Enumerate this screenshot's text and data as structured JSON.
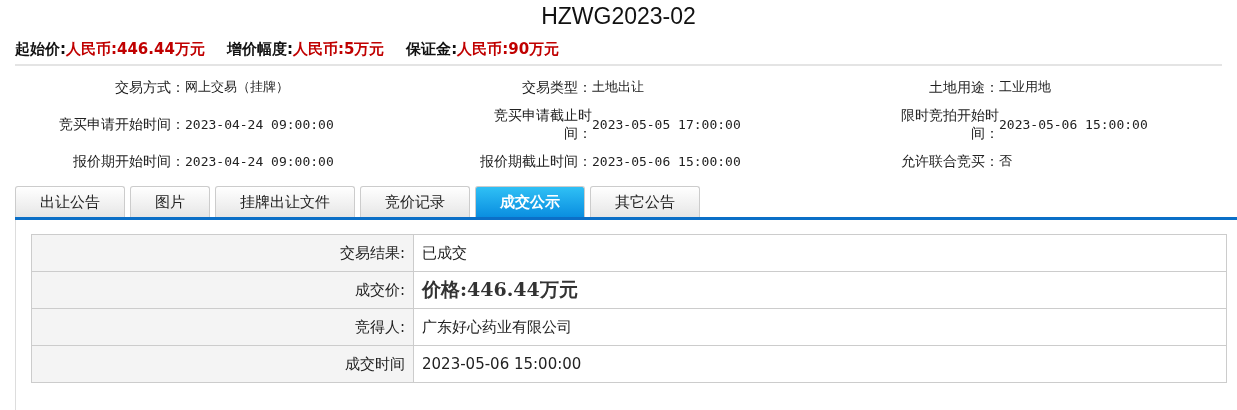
{
  "title": "HZWG2023-02",
  "prices": [
    {
      "label": "起始价:",
      "value": "人民币:446.44万元"
    },
    {
      "label": "增价幅度:",
      "value": "人民币:5万元"
    },
    {
      "label": "保证金:",
      "value": "人民币:90万元"
    }
  ],
  "info": [
    {
      "label": "交易方式：",
      "value": "网上交易（挂牌）"
    },
    {
      "label": "交易类型：",
      "value": "土地出让"
    },
    {
      "label": "土地用途：",
      "value": "工业用地"
    },
    {
      "label": "竞买申请开始时间：",
      "value": "2023-04-24 09:00:00"
    },
    {
      "label": "竞买申请截止时间：",
      "value": "2023-05-05 17:00:00"
    },
    {
      "label": "限时竞拍开始时间：",
      "value": "2023-05-06 15:00:00"
    },
    {
      "label": "报价期开始时间：",
      "value": "2023-04-24 09:00:00"
    },
    {
      "label": "报价期截止时间：",
      "value": "2023-05-06 15:00:00"
    },
    {
      "label": "允许联合竞买：",
      "value": "否"
    }
  ],
  "tabs": [
    {
      "label": "出让公告",
      "selected": false
    },
    {
      "label": "图片",
      "selected": false
    },
    {
      "label": "挂牌出让文件",
      "selected": false
    },
    {
      "label": "竞价记录",
      "selected": false
    },
    {
      "label": "成交公示",
      "selected": true
    },
    {
      "label": "其它公告",
      "selected": false
    }
  ],
  "result": [
    {
      "kind": "text",
      "label": "交易结果:",
      "value": "已成交"
    },
    {
      "kind": "price",
      "label": "成交价:",
      "value": "价格:446.44万元"
    },
    {
      "kind": "text",
      "label": "竞得人:",
      "value": "广东好心药业有限公司"
    },
    {
      "kind": "text",
      "label": "成交时间",
      "value": "2023-05-06 15:00:00"
    }
  ]
}
